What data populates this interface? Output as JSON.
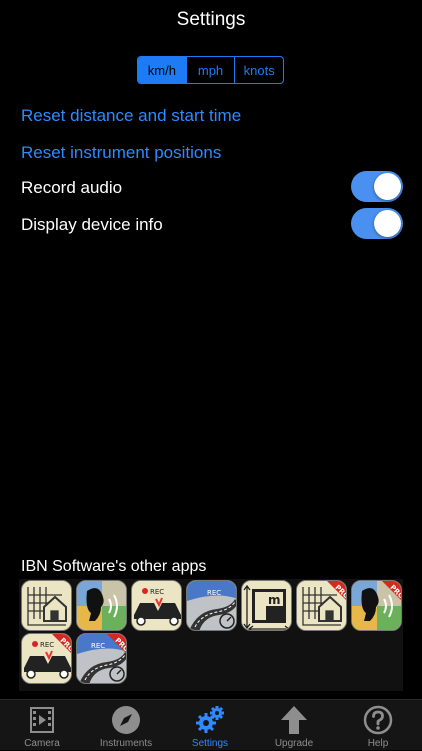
{
  "nav": {
    "title": "Settings"
  },
  "units": {
    "options": [
      "km/h",
      "mph",
      "knots"
    ],
    "selected": "km/h"
  },
  "actions": {
    "reset_distance": "Reset distance and start time",
    "reset_positions": "Reset instrument positions"
  },
  "toggles": [
    {
      "label": "Record audio",
      "on": true
    },
    {
      "label": "Display device info",
      "on": true
    }
  ],
  "other_apps": {
    "title": "IBN Software's other apps",
    "apps": [
      {
        "icon": "house-floorplan-app-icon"
      },
      {
        "icon": "voice-app-icon"
      },
      {
        "icon": "dashcam-crash-app-icon"
      },
      {
        "icon": "road-speed-app-icon"
      },
      {
        "icon": "measure-m-app-icon"
      },
      {
        "icon": "house-floorplan-pro-app-icon",
        "badge": "PRO"
      },
      {
        "icon": "voice-pro-app-icon",
        "badge": "PRO"
      },
      {
        "icon": "dashcam-crash-pro-app-icon",
        "badge": "PRO"
      },
      {
        "icon": "road-speed-pro-app-icon",
        "badge": "PRO"
      }
    ]
  },
  "tabbar": {
    "items": [
      {
        "label": "Camera",
        "icon": "film-icon"
      },
      {
        "label": "Instruments",
        "icon": "compass-icon"
      },
      {
        "label": "Settings",
        "icon": "gears-icon",
        "active": true
      },
      {
        "label": "Upgrade",
        "icon": "up-arrow-icon"
      },
      {
        "label": "Help",
        "icon": "question-icon"
      }
    ]
  },
  "colors": {
    "accent": "#2f89ff",
    "toggle_on": "#4a90f0",
    "background": "#000000"
  }
}
